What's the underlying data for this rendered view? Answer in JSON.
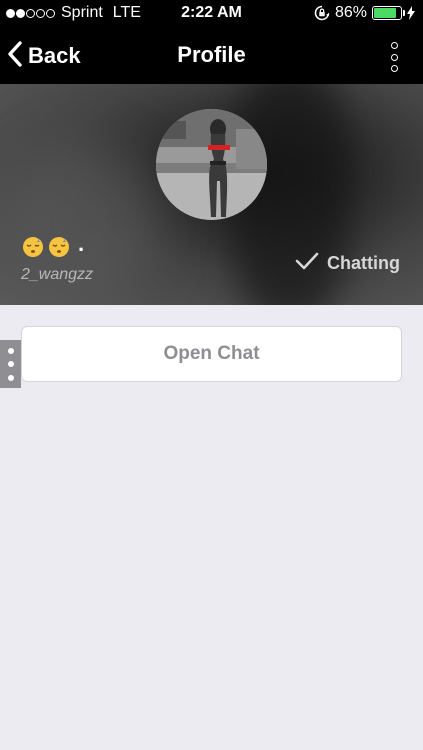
{
  "status_bar": {
    "carrier": "Sprint",
    "network": "LTE",
    "time": "2:22 AM",
    "battery_percent": "86%",
    "battery_level": 0.86,
    "signal_strength": 2,
    "signal_max": 5,
    "icons": [
      "signal-dots-icon",
      "orientation-lock-icon",
      "battery-icon",
      "charging-bolt-icon"
    ]
  },
  "nav_bar": {
    "back_label": "Back",
    "title": "Profile",
    "back_icon": "chevron-left-icon",
    "more_icon": "vertical-dots-icon"
  },
  "profile": {
    "display_name_emoji": [
      "sleeping-face-emoji",
      "sleeping-face-emoji"
    ],
    "display_name_suffix": ".",
    "username": "2_wangzz",
    "status_label": "Chatting",
    "status_icon": "checkmark-icon"
  },
  "main": {
    "open_chat_label": "Open Chat",
    "side_handle_icon": "vertical-dots-icon"
  },
  "colors": {
    "status_bar_bg": "#000000",
    "battery_green": "#4cd964",
    "page_bg": "#ebebf1",
    "button_text": "#8e8e93",
    "avatar_accent_red": "#d42323"
  }
}
